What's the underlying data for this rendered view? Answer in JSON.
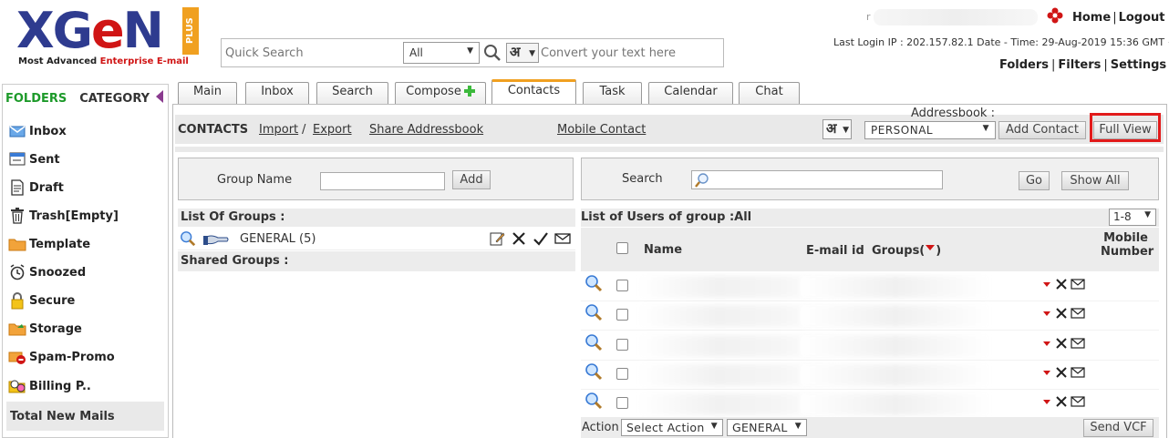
{
  "brand": {
    "logo_text_pre": "XG",
    "logo_text_o": "e",
    "logo_text_post": "N",
    "logo_plus": "PLUS",
    "tagline_1": "Most Advanced ",
    "tagline_2": "Enterprise E-mail",
    "accent_red": "#d01515",
    "accent_blue": "#2e3b8f",
    "accent_orange": "#f0a020"
  },
  "search": {
    "placeholder": "Quick Search",
    "scope": "All",
    "hindi_glyph": "अ",
    "convert_placeholder": "Convert your text here"
  },
  "user": {
    "initial": "r",
    "home": "Home",
    "logout": "Logout",
    "last_login": "Last Login IP : 202.157.82.1 Date - Time: 29-Aug-2019 15:36 GMT + 5:30",
    "folders": "Folders",
    "filters": "Filters",
    "settings": "Settings"
  },
  "sidebar": {
    "folders_label": "FOLDERS",
    "category_label": "CATEGORY",
    "items": [
      {
        "label": "Inbox",
        "icon": "inbox-icon"
      },
      {
        "label": "Sent",
        "icon": "sent-icon"
      },
      {
        "label": "Draft",
        "icon": "draft-icon"
      },
      {
        "label": "Trash[Empty]",
        "icon": "trash-icon"
      },
      {
        "label": "Template",
        "icon": "folder-icon"
      },
      {
        "label": "Snoozed",
        "icon": "alarm-icon"
      },
      {
        "label": "Secure",
        "icon": "lock-icon"
      },
      {
        "label": "Storage",
        "icon": "storage-icon"
      },
      {
        "label": "Spam-Promo",
        "icon": "spam-icon"
      },
      {
        "label": "Billing P..",
        "icon": "billing-icon"
      }
    ],
    "total_new_mails": "Total New Mails"
  },
  "tabs": [
    {
      "label": "Main"
    },
    {
      "label": "Inbox"
    },
    {
      "label": "Search"
    },
    {
      "label": "Compose"
    },
    {
      "label": "Contacts"
    },
    {
      "label": "Task"
    },
    {
      "label": "Calendar"
    },
    {
      "label": "Chat"
    }
  ],
  "toolbar": {
    "title": "CONTACTS",
    "import": "Import",
    "slash": "/",
    "export": "Export",
    "share": "Share Addressbook",
    "mobile": "Mobile Contact",
    "addressbook_label": "Addressbook :",
    "addressbook_value": "PERSONAL",
    "add_contact": "Add Contact",
    "full_view": "Full View"
  },
  "groups": {
    "group_name_label": "Group Name",
    "add": "Add",
    "list_header": "List Of Groups :",
    "items": [
      {
        "name": "GENERAL (5)"
      }
    ],
    "shared_header": "Shared Groups :"
  },
  "users": {
    "search_label": "Search",
    "go": "Go",
    "show_all": "Show All",
    "list_header": "List of Users of group :All",
    "page_range": "1-8",
    "col_name": "Name",
    "col_email": "E-mail id",
    "col_groups": "Groups(",
    "col_groups_close": ")",
    "col_mobile_1": "Mobile",
    "col_mobile_2": "Number",
    "row_count": 5
  },
  "footer": {
    "action_label": "Action",
    "select_action": "Select Action",
    "group_sel": "GENERAL",
    "send_vcf": "Send VCF"
  }
}
